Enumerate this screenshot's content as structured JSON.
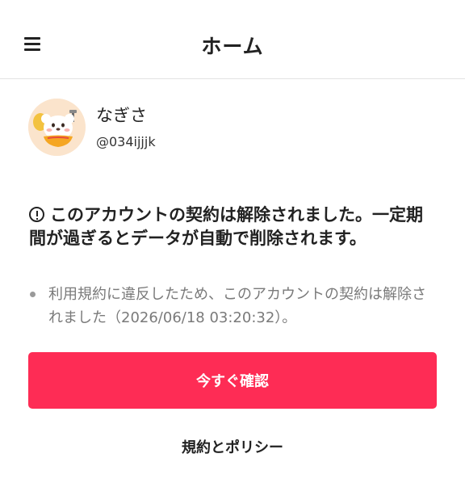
{
  "header": {
    "menu_icon": "hamburger-menu-icon",
    "title": "ホーム"
  },
  "profile": {
    "avatar_icon": "chef-mascot-avatar",
    "name": "なぎさ",
    "handle": "@034ijjjk"
  },
  "notice": {
    "icon": "exclamation-circle-icon",
    "title": "このアカウントの契約は解除されました。一定期間が過ぎるとデータが自動で削除されます。",
    "details": [
      "利用規約に違反したため、このアカウントの契約は解除されました（2026/06/18 03:20:32）。"
    ]
  },
  "actions": {
    "confirm_label": "今すぐ確認",
    "policy_label": "規約とポリシー"
  },
  "colors": {
    "accent": "#fe2c55",
    "text": "#222222",
    "muted_text": "#7a7a7a",
    "divider": "#e3e3e3"
  }
}
